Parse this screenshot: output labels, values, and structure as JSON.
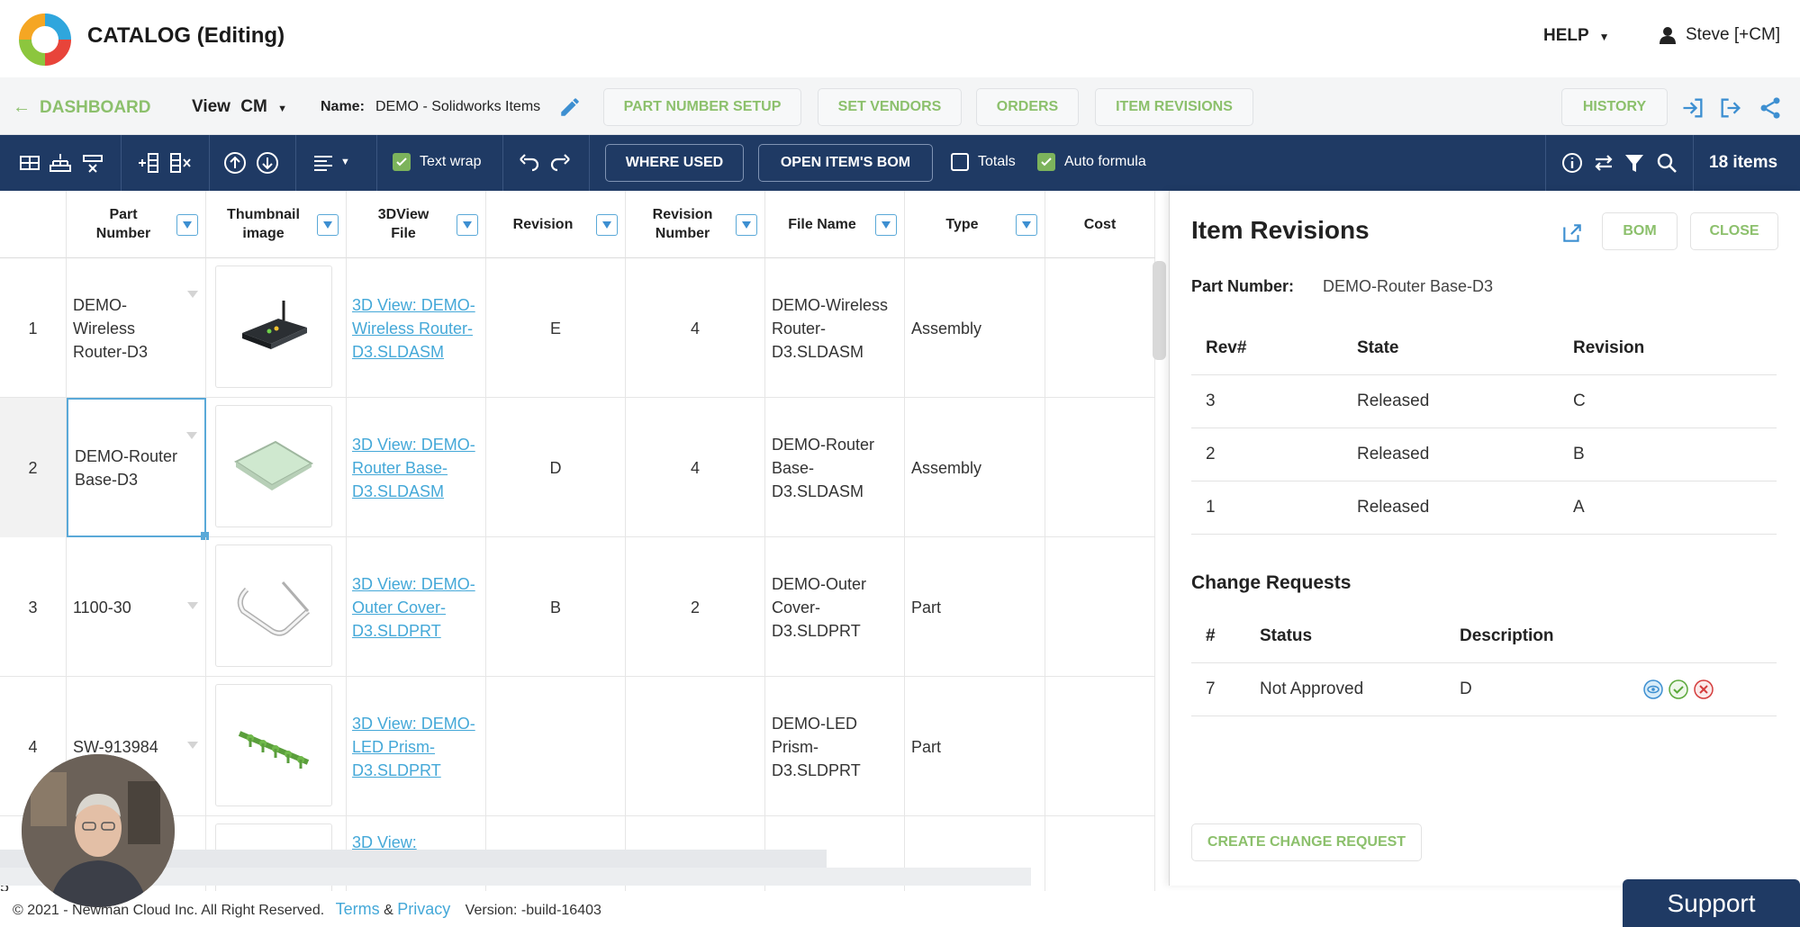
{
  "header": {
    "app_title": "CATALOG (Editing)",
    "help_label": "HELP",
    "user_label": "Steve [+CM]"
  },
  "nav": {
    "back_label": "DASHBOARD",
    "view_label": "View",
    "view_value": "CM",
    "name_label": "Name:",
    "name_value": "DEMO - Solidworks Items",
    "buttons": [
      "PART NUMBER SETUP",
      "SET VENDORS",
      "ORDERS",
      "ITEM REVISIONS",
      "HISTORY"
    ]
  },
  "toolbar": {
    "text_wrap_label": "Text wrap",
    "text_wrap_checked": true,
    "where_used_label": "WHERE USED",
    "open_bom_label": "OPEN ITEM'S BOM",
    "totals_label": "Totals",
    "totals_checked": false,
    "auto_formula_label": "Auto formula",
    "auto_formula_checked": true,
    "items_count": "18 items"
  },
  "grid": {
    "columns": [
      "Part Number",
      "Thumbnail image",
      "3DView File",
      "Revision",
      "Revision Number",
      "File Name",
      "Type",
      "Cost"
    ],
    "rows": [
      {
        "num": "1",
        "part_number": "DEMO-Wireless Router-D3",
        "view_file": "3D View: DEMO-Wireless Router-D3.SLDASM",
        "revision": "E",
        "revision_number": "4",
        "file_name": "DEMO-Wireless Router-D3.SLDASM",
        "type": "Assembly",
        "cost": ""
      },
      {
        "num": "2",
        "part_number": "DEMO-Router Base-D3",
        "view_file": "3D View: DEMO-Router Base-D3.SLDASM",
        "revision": "D",
        "revision_number": "4",
        "file_name": "DEMO-Router Base-D3.SLDASM",
        "type": "Assembly",
        "cost": ""
      },
      {
        "num": "3",
        "part_number": "1100-30",
        "view_file": "3D View: DEMO-Outer Cover-D3.SLDPRT",
        "revision": "B",
        "revision_number": "2",
        "file_name": "DEMO-Outer Cover-D3.SLDPRT",
        "type": "Part",
        "cost": ""
      },
      {
        "num": "4",
        "part_number": "SW-913984",
        "view_file": "3D View: DEMO-LED Prism-D3.SLDPRT",
        "revision": "",
        "revision_number": "",
        "file_name": "DEMO-LED Prism-D3.SLDPRT",
        "type": "Part",
        "cost": ""
      },
      {
        "num": "5",
        "part_number": "",
        "view_file": "3D View:",
        "revision": "",
        "revision_number": "",
        "file_name": "",
        "type": "",
        "cost": ""
      }
    ]
  },
  "panel": {
    "title": "Item Revisions",
    "bom_label": "BOM",
    "close_label": "CLOSE",
    "part_number_label": "Part Number:",
    "part_number_value": "DEMO-Router Base-D3",
    "rev_headers": [
      "Rev#",
      "State",
      "Revision"
    ],
    "revisions": [
      {
        "rev": "3",
        "state": "Released",
        "revision": "C"
      },
      {
        "rev": "2",
        "state": "Released",
        "revision": "B"
      },
      {
        "rev": "1",
        "state": "Released",
        "revision": "A"
      }
    ],
    "change_requests_title": "Change Requests",
    "cr_headers": [
      "#",
      "Status",
      "Description"
    ],
    "change_requests": [
      {
        "num": "7",
        "status": "Not Approved",
        "description": "D"
      }
    ],
    "create_cr_label": "CREATE CHANGE REQUEST"
  },
  "footer": {
    "copyright": "© 2021 - Newman Cloud Inc. All Right Reserved.",
    "terms": "Terms",
    "amp": "&",
    "privacy": "Privacy",
    "version": "Version: -build-16403",
    "support_label": "Support"
  },
  "colors": {
    "navy": "#1f3a64",
    "green": "#8cc06c",
    "link_blue": "#44a8d8"
  }
}
